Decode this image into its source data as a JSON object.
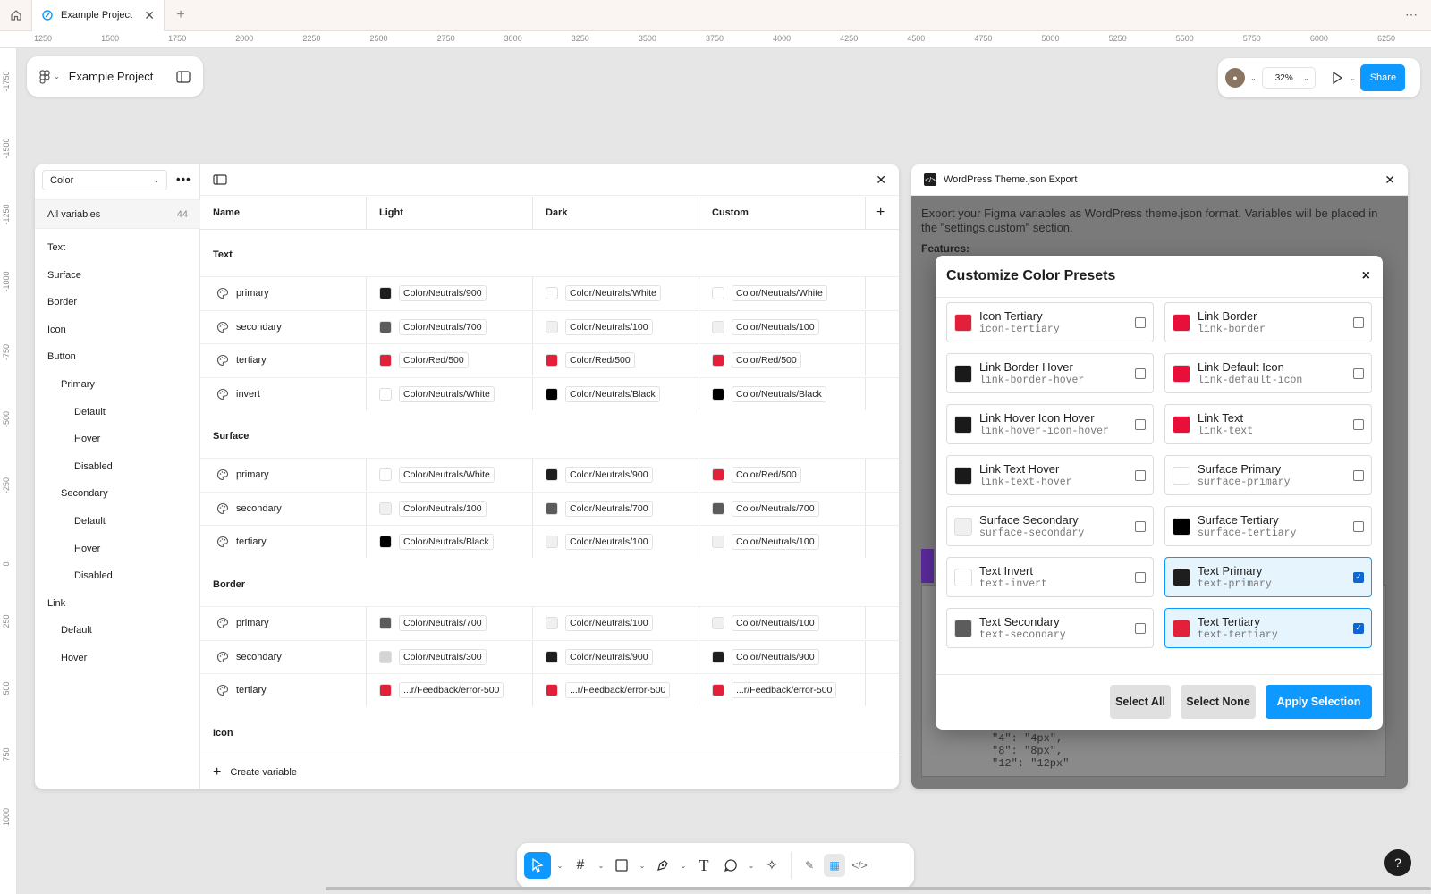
{
  "tabs": {
    "home_icon": "home-icon",
    "active_title": "Example Project",
    "more": "⋯"
  },
  "ruler_top": [
    "1250",
    "1500",
    "1750",
    "2000",
    "2250",
    "2500",
    "2750",
    "3000",
    "3250",
    "3500",
    "3750",
    "4000",
    "4250",
    "4500",
    "4750",
    "5000",
    "5250",
    "5500",
    "5750",
    "6000",
    "6250"
  ],
  "ruler_left": [
    "-1750",
    "-1500",
    "-1250",
    "-1000",
    "-750",
    "-500",
    "-250",
    "0",
    "250",
    "500",
    "750",
    "1000"
  ],
  "project": {
    "name": "Example Project"
  },
  "controls": {
    "zoom": "32%",
    "share": "Share"
  },
  "variables": {
    "collection": "Color",
    "all_label": "All variables",
    "all_count": "44",
    "groups": [
      "Text",
      "Surface",
      "Border",
      "Icon",
      "Button",
      "Primary",
      "Default",
      "Hover",
      "Disabled",
      "Secondary",
      "Default",
      "Hover",
      "Disabled",
      "Link",
      "Default",
      "Hover"
    ],
    "columns": [
      "Name",
      "Light",
      "Dark",
      "Custom"
    ],
    "sections": [
      {
        "title": "Text",
        "rows": [
          {
            "name": "primary",
            "light": {
              "c": "#1e1e1e",
              "v": "Color/Neutrals/900"
            },
            "dark": {
              "c": "#ffffff",
              "v": "Color/Neutrals/White"
            },
            "custom": {
              "c": "#ffffff",
              "v": "Color/Neutrals/White"
            }
          },
          {
            "name": "secondary",
            "light": {
              "c": "#5c5c5c",
              "v": "Color/Neutrals/700"
            },
            "dark": {
              "c": "#f0f0f0",
              "v": "Color/Neutrals/100"
            },
            "custom": {
              "c": "#f0f0f0",
              "v": "Color/Neutrals/100"
            }
          },
          {
            "name": "tertiary",
            "light": {
              "c": "#e3203a",
              "v": "Color/Red/500"
            },
            "dark": {
              "c": "#e3203a",
              "v": "Color/Red/500"
            },
            "custom": {
              "c": "#e3203a",
              "v": "Color/Red/500"
            }
          },
          {
            "name": "invert",
            "light": {
              "c": "#ffffff",
              "v": "Color/Neutrals/White"
            },
            "dark": {
              "c": "#000000",
              "v": "Color/Neutrals/Black"
            },
            "custom": {
              "c": "#000000",
              "v": "Color/Neutrals/Black"
            }
          }
        ]
      },
      {
        "title": "Surface",
        "rows": [
          {
            "name": "primary",
            "light": {
              "c": "#ffffff",
              "v": "Color/Neutrals/White"
            },
            "dark": {
              "c": "#1e1e1e",
              "v": "Color/Neutrals/900"
            },
            "custom": {
              "c": "#e3203a",
              "v": "Color/Red/500"
            }
          },
          {
            "name": "secondary",
            "light": {
              "c": "#f0f0f0",
              "v": "Color/Neutrals/100"
            },
            "dark": {
              "c": "#5c5c5c",
              "v": "Color/Neutrals/700"
            },
            "custom": {
              "c": "#5c5c5c",
              "v": "Color/Neutrals/700"
            }
          },
          {
            "name": "tertiary",
            "light": {
              "c": "#000000",
              "v": "Color/Neutrals/Black"
            },
            "dark": {
              "c": "#f0f0f0",
              "v": "Color/Neutrals/100"
            },
            "custom": {
              "c": "#f0f0f0",
              "v": "Color/Neutrals/100"
            }
          }
        ]
      },
      {
        "title": "Border",
        "rows": [
          {
            "name": "primary",
            "light": {
              "c": "#5c5c5c",
              "v": "Color/Neutrals/700"
            },
            "dark": {
              "c": "#f0f0f0",
              "v": "Color/Neutrals/100"
            },
            "custom": {
              "c": "#f0f0f0",
              "v": "Color/Neutrals/100"
            }
          },
          {
            "name": "secondary",
            "light": {
              "c": "#d4d4d4",
              "v": "Color/Neutrals/300"
            },
            "dark": {
              "c": "#1e1e1e",
              "v": "Color/Neutrals/900"
            },
            "custom": {
              "c": "#1e1e1e",
              "v": "Color/Neutrals/900"
            }
          },
          {
            "name": "tertiary",
            "light": {
              "c": "#e3203a",
              "v": "...r/Feedback/error-500"
            },
            "dark": {
              "c": "#e3203a",
              "v": "...r/Feedback/error-500"
            },
            "custom": {
              "c": "#e3203a",
              "v": "...r/Feedback/error-500"
            }
          }
        ]
      },
      {
        "title": "Icon",
        "rows": []
      }
    ],
    "create_label": "Create variable"
  },
  "plugin": {
    "title": "WordPress Theme.json Export",
    "bg_text": "Export your Figma variables as WordPress theme.json format. Variables will be placed in the \"settings.custom\" section.",
    "bg_features": "Features:",
    "bg_code": "\"4\": \"4px\",\n\"8\": \"8px\",\n\"12\": \"12px\""
  },
  "modal": {
    "title": "Customize Color Presets",
    "close": "×",
    "presets": [
      {
        "label": "Icon Tertiary",
        "slug": "icon-tertiary",
        "color": "#e3203a",
        "checked": false
      },
      {
        "label": "Link Border",
        "slug": "link-border",
        "color": "#e8103a",
        "checked": false
      },
      {
        "label": "Link Border Hover",
        "slug": "link-border-hover",
        "color": "#1a1a1a",
        "checked": false
      },
      {
        "label": "Link Default Icon",
        "slug": "link-default-icon",
        "color": "#e8103a",
        "checked": false
      },
      {
        "label": "Link Hover Icon Hover",
        "slug": "link-hover-icon-hover",
        "color": "#1a1a1a",
        "checked": false
      },
      {
        "label": "Link Text",
        "slug": "link-text",
        "color": "#e8103a",
        "checked": false
      },
      {
        "label": "Link Text Hover",
        "slug": "link-text-hover",
        "color": "#1a1a1a",
        "checked": false
      },
      {
        "label": "Surface Primary",
        "slug": "surface-primary",
        "color": "#ffffff",
        "checked": false
      },
      {
        "label": "Surface Secondary",
        "slug": "surface-secondary",
        "color": "#f0f0f0",
        "checked": false
      },
      {
        "label": "Surface Tertiary",
        "slug": "surface-tertiary",
        "color": "#000000",
        "checked": false
      },
      {
        "label": "Text Invert",
        "slug": "text-invert",
        "color": "#ffffff",
        "checked": false
      },
      {
        "label": "Text Primary",
        "slug": "text-primary",
        "color": "#1e1e1e",
        "checked": true
      },
      {
        "label": "Text Secondary",
        "slug": "text-secondary",
        "color": "#5c5c5c",
        "checked": false
      },
      {
        "label": "Text Tertiary",
        "slug": "text-tertiary",
        "color": "#e3203a",
        "checked": true
      }
    ],
    "select_all": "Select All",
    "select_none": "Select None",
    "apply": "Apply Selection"
  },
  "help": "?"
}
